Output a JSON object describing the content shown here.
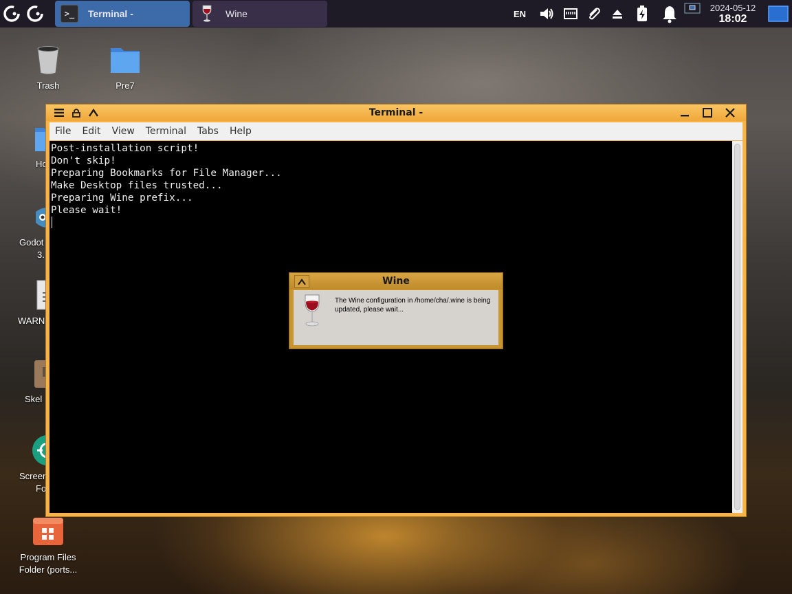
{
  "panel": {
    "tasks": [
      {
        "label": "Terminal -",
        "icon": "terminal-icon"
      },
      {
        "label": "Wine",
        "icon": "wine-glass-icon"
      }
    ],
    "language": "EN",
    "clock": {
      "date": "2024-05-12",
      "time": "18:02"
    }
  },
  "desktop_icons": [
    {
      "label": "Trash",
      "icon": "trash-icon"
    },
    {
      "label": "Pre7",
      "icon": "folder-icon"
    },
    {
      "label": "Ho",
      "icon": "home-folder-icon"
    },
    {
      "label": "Godot",
      "label2": "3.",
      "icon": "godot-icon"
    },
    {
      "label": "WARN",
      "icon": "document-icon"
    },
    {
      "label": "Skel",
      "icon": "archive-icon"
    },
    {
      "label": "Screen",
      "label2": "Fo",
      "icon": "screenshot-icon"
    },
    {
      "label": "Program Files",
      "label2": "Folder (ports...",
      "icon": "program-files-icon"
    }
  ],
  "terminal": {
    "title": "Terminal -",
    "menu": [
      "File",
      "Edit",
      "View",
      "Terminal",
      "Tabs",
      "Help"
    ],
    "lines": [
      "Post-installation script!",
      "Don't skip!",
      "Preparing Bookmarks for File Manager...",
      "Make Desktop files trusted...",
      "Preparing Wine prefix...",
      "Please wait!"
    ]
  },
  "wine_dialog": {
    "title": "Wine",
    "message": "The Wine configuration in /home/cha/.wine is being updated, please wait..."
  },
  "colors": {
    "panel_bg": "#1e1a26",
    "active_task": "#3d6aa8",
    "window_frame": "#f4b44a",
    "terminal_bg": "#000000",
    "terminal_fg": "#f0f0f0"
  }
}
